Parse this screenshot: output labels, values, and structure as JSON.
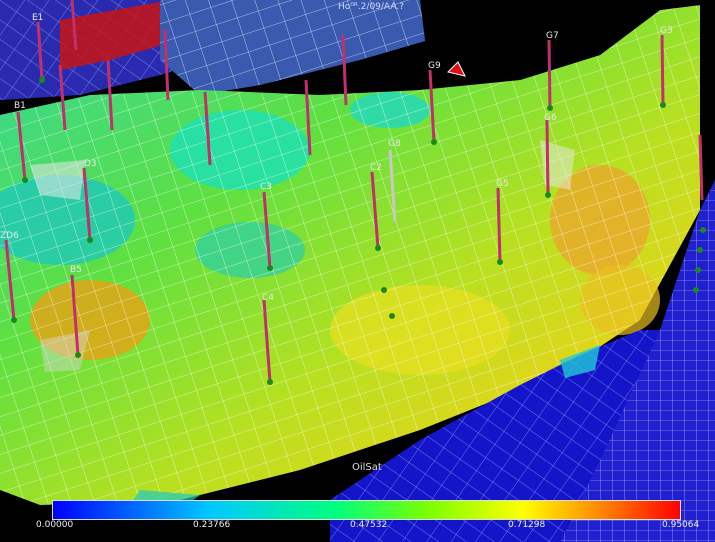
{
  "viewport": {
    "top_label": "Ho⁰ᴿ.2/09/AA.?",
    "property_name": "OilSat"
  },
  "legend": {
    "property": "OilSat",
    "min": "0.00000",
    "ticks": [
      "0.00000",
      "0.23766",
      "0.47532",
      "0.71298",
      "0.95064"
    ],
    "colors": [
      "#0000ff",
      "#00c8ff",
      "#00ff80",
      "#7cff00",
      "#ffff00",
      "#ff8000",
      "#ff0000"
    ]
  },
  "wells": [
    {
      "label": "E1"
    },
    {
      "label": "B1"
    },
    {
      "label": "D3"
    },
    {
      "label": "ZD6"
    },
    {
      "label": "B5"
    },
    {
      "label": "C3"
    },
    {
      "label": "C4"
    },
    {
      "label": "G8"
    },
    {
      "label": "G9"
    },
    {
      "label": "G7"
    },
    {
      "label": "G6"
    },
    {
      "label": "G5"
    },
    {
      "label": "G3"
    },
    {
      "label": "C2"
    }
  ]
}
